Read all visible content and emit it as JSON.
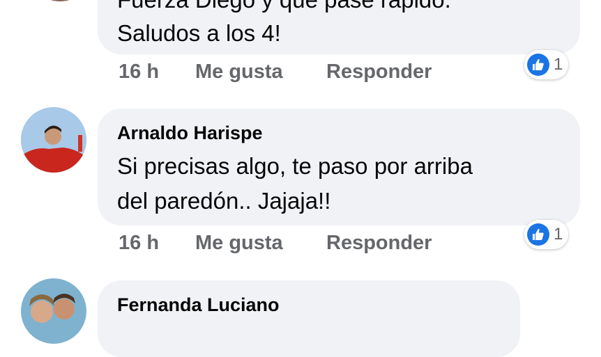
{
  "comments": [
    {
      "author": "",
      "text_lines": [
        "Fuerza Diego y que pase rápido.",
        "Saludos a los 4!"
      ],
      "time": "16 h",
      "like": "Me gusta",
      "reply": "Responder",
      "reaction_count": "1"
    },
    {
      "author": "Arnaldo Harispe",
      "text_lines": [
        "Si precisas algo, te paso por arriba",
        "del paredón.. Jajaja!!"
      ],
      "time": "16 h",
      "like": "Me gusta",
      "reply": "Responder",
      "reaction_count": "1"
    },
    {
      "author": "Fernanda Luciano"
    }
  ],
  "colors": {
    "bubble": "#f0f2f5",
    "like_blue": "#1b74e4",
    "meta_text": "#65676b"
  }
}
